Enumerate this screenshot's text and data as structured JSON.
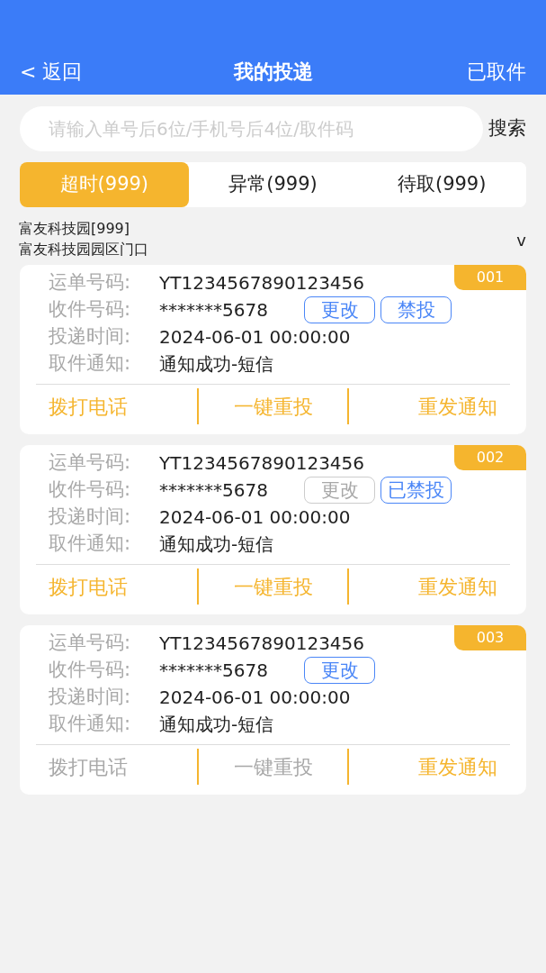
{
  "header": {
    "back": "< 返回",
    "title": "我的投递",
    "right": "已取件"
  },
  "search": {
    "placeholder": "请输入单号后6位/手机号后4位/取件码",
    "button": "搜索"
  },
  "tabs": [
    {
      "label": "超时(999)",
      "selected": true
    },
    {
      "label": "异常(999)",
      "selected": false
    },
    {
      "label": "待取(999)",
      "selected": false
    }
  ],
  "location": {
    "name": "富友科技园[999]",
    "place": "富友科技园园区门口",
    "toggle": "v"
  },
  "orders": [
    {
      "number": "001",
      "fields": [
        {
          "label": "运单号码:",
          "value": "YT1234567890123456"
        },
        {
          "label": "收件号码:",
          "value": "*******5678",
          "buttons": [
            {
              "label": "更改",
              "disabled": false
            },
            {
              "label": "禁投",
              "disabled": false
            }
          ]
        },
        {
          "label": "投递时间:",
          "value": "2024-06-01 00:00:00"
        },
        {
          "label": "取件通知:",
          "value": "通知成功-短信"
        }
      ],
      "actions": [
        {
          "label": "拨打电话",
          "disabled": false
        },
        {
          "label": "一键重投",
          "disabled": false
        },
        {
          "label": "重发通知",
          "disabled": false
        }
      ]
    },
    {
      "number": "002",
      "fields": [
        {
          "label": "运单号码:",
          "value": "YT1234567890123456"
        },
        {
          "label": "收件号码:",
          "value": "*******5678",
          "buttons": [
            {
              "label": "更改",
              "disabled": true
            },
            {
              "label": "已禁投",
              "disabled": false
            }
          ]
        },
        {
          "label": "投递时间:",
          "value": "2024-06-01 00:00:00"
        },
        {
          "label": "取件通知:",
          "value": "通知成功-短信"
        }
      ],
      "actions": [
        {
          "label": "拨打电话",
          "disabled": false
        },
        {
          "label": "一键重投",
          "disabled": false
        },
        {
          "label": "重发通知",
          "disabled": false
        }
      ]
    },
    {
      "number": "003",
      "fields": [
        {
          "label": "运单号码:",
          "value": "YT1234567890123456"
        },
        {
          "label": "收件号码:",
          "value": "*******5678",
          "buttons": [
            {
              "label": "更改",
              "disabled": false
            }
          ]
        },
        {
          "label": "投递时间:",
          "value": "2024-06-01 00:00:00"
        },
        {
          "label": "取件通知:",
          "value": "通知成功-短信"
        }
      ],
      "actions": [
        {
          "label": "拨打电话",
          "disabled": true
        },
        {
          "label": "一键重投",
          "disabled": true
        },
        {
          "label": "重发通知",
          "disabled": false
        }
      ]
    }
  ]
}
